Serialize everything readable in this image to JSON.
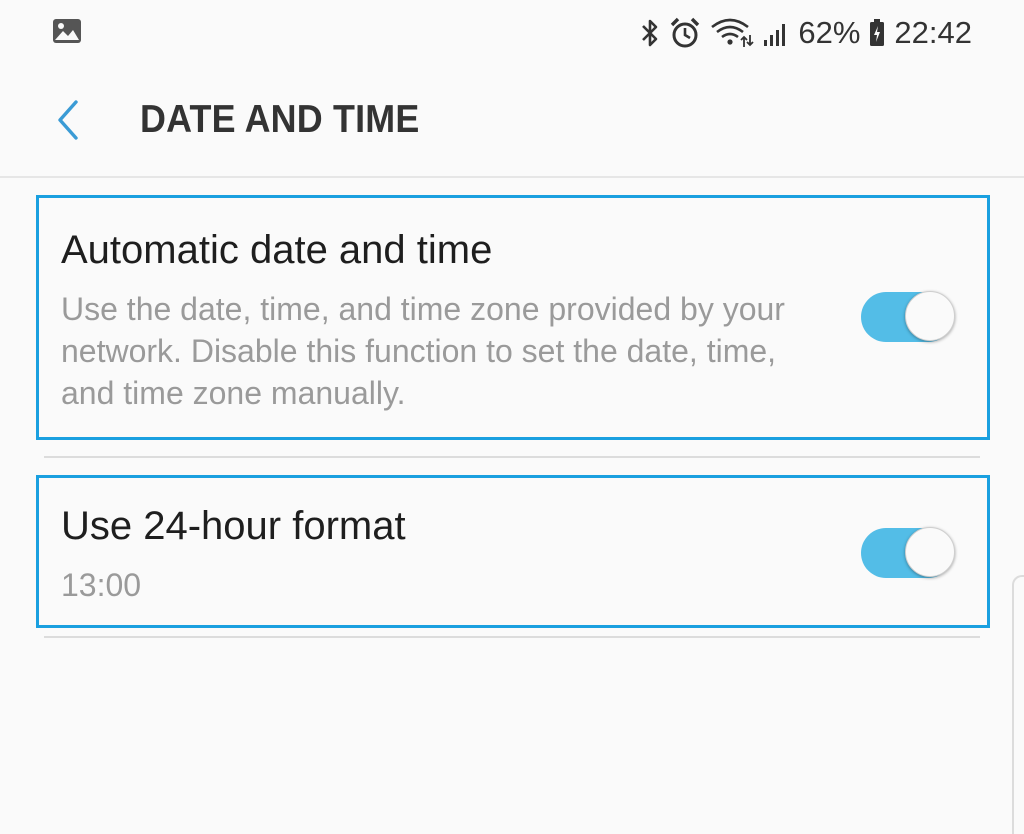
{
  "status_bar": {
    "battery_percent": "62%",
    "time": "22:42",
    "icons": [
      "gallery-icon",
      "bluetooth-icon",
      "alarm-icon",
      "wifi-icon",
      "signal-icon",
      "battery-charging-icon"
    ]
  },
  "header": {
    "title": "DATE AND TIME",
    "back_icon": "chevron-left-icon"
  },
  "settings": [
    {
      "title": "Automatic date and time",
      "description": "Use the date, time, and time zone provided by your network. Disable this function to set the date, time, and time zone manually.",
      "enabled": true
    },
    {
      "title": "Use 24-hour format",
      "description": "13:00",
      "enabled": true
    }
  ],
  "colors": {
    "accent": "#53bde7",
    "highlight_border": "#1aa0e0",
    "back_arrow": "#3a9bd5"
  }
}
